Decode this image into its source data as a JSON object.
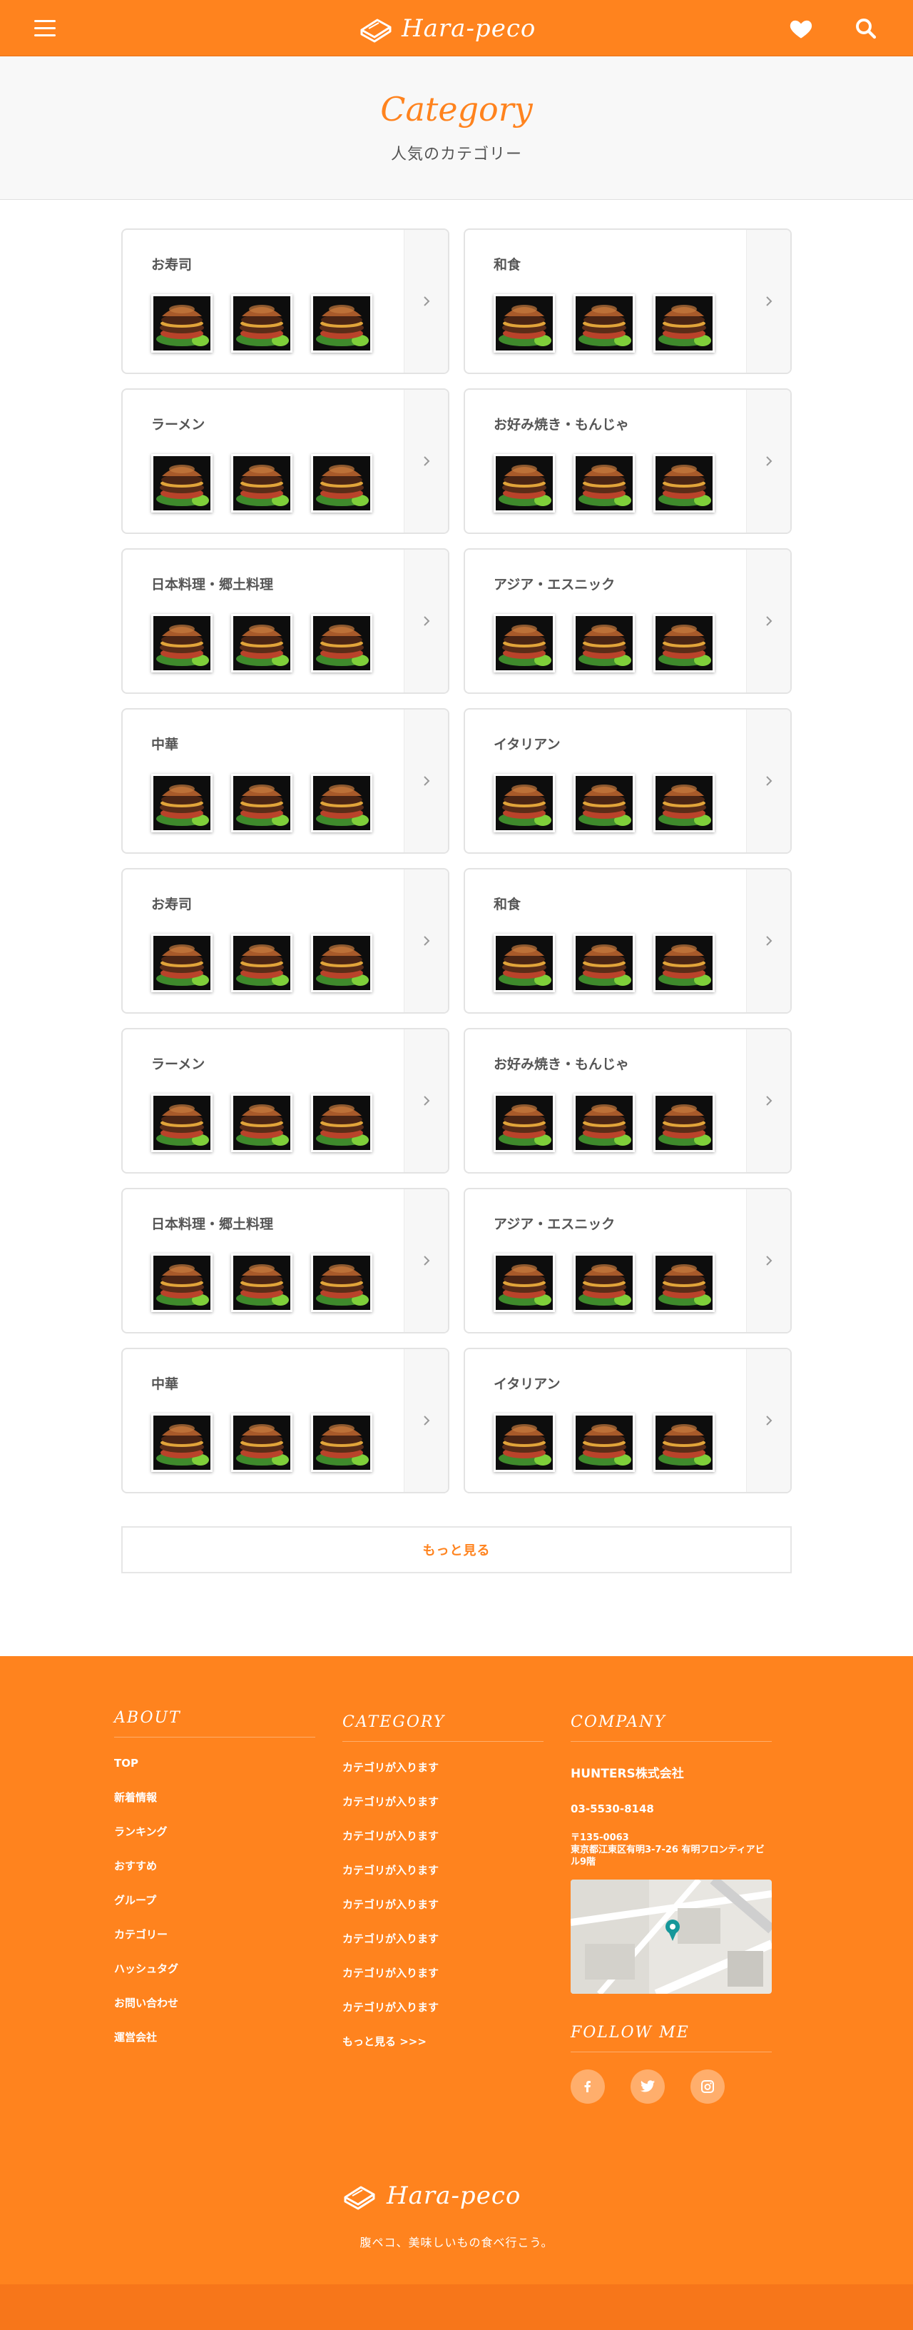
{
  "header": {
    "logo_text": "Hara-peco",
    "menu_icon": "hamburger-menu-icon",
    "favorite_icon": "heart-icon",
    "search_icon": "search-icon"
  },
  "hero": {
    "title": "Category",
    "subtitle": "人気のカテゴリー"
  },
  "categories": [
    "お寿司",
    "和食",
    "ラーメン",
    "お好み焼き・もんじゃ",
    "日本料理・郷土料理",
    "アジア・エスニック",
    "中華",
    "イタリアン",
    "お寿司",
    "和食",
    "ラーメン",
    "お好み焼き・もんじゃ",
    "日本料理・郷土料理",
    "アジア・エスニック",
    "中華",
    "イタリアン"
  ],
  "more_label": "もっと見る",
  "footer": {
    "about": {
      "heading": "ABOUT",
      "items": [
        "TOP",
        "新着情報",
        "ランキング",
        "おすすめ",
        "グループ",
        "カテゴリー",
        "ハッシュタグ",
        "お問い合わせ",
        "運営会社"
      ]
    },
    "category": {
      "heading": "CATEGORY",
      "items": [
        "カテゴリが入ります",
        "カテゴリが入ります",
        "カテゴリが入ります",
        "カテゴリが入ります",
        "カテゴリが入ります",
        "カテゴリが入ります",
        "カテゴリが入ります",
        "カテゴリが入ります",
        "もっと見る >>>"
      ]
    },
    "company": {
      "heading": "COMPANY",
      "name": "HUNTERS株式会社",
      "tel": "03-5530-8148",
      "zip": "〒135-0063",
      "address": "東京都江東区有明3-7-26 有明フロンティアビル9階"
    },
    "follow": {
      "heading": "FOLLOW ME",
      "icons": [
        "facebook-icon",
        "twitter-icon",
        "instagram-icon"
      ]
    },
    "logo_text": "Hara-peco",
    "tagline": "腹ペコ、美味しいもの食べ行こう。"
  },
  "colors": {
    "accent": "#FF831E",
    "footer_bottom": "#F7761A"
  }
}
